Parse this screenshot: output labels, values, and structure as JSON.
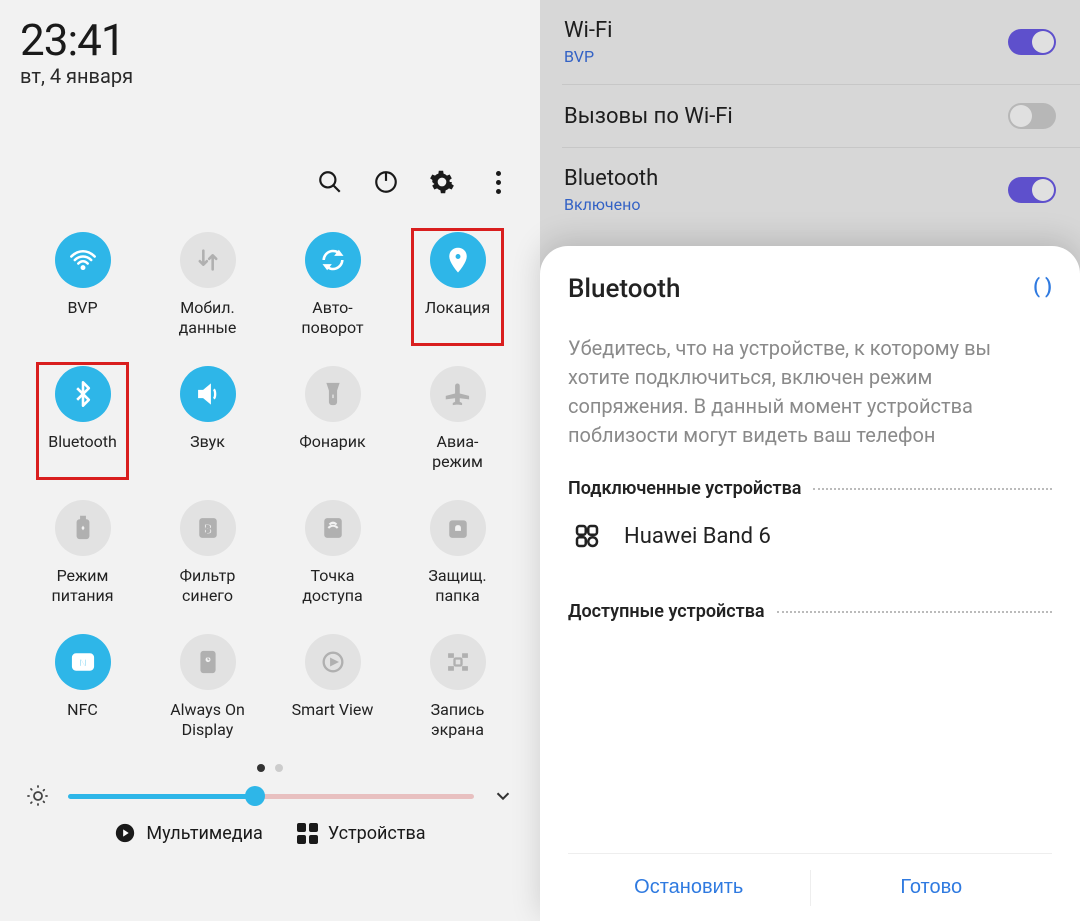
{
  "left": {
    "time": "23:41",
    "date": "вт, 4 января",
    "tiles": [
      {
        "icon": "wifi",
        "on": true,
        "label": "BVP",
        "hl": false,
        "name": "tile-wifi"
      },
      {
        "icon": "data",
        "on": false,
        "label": "Мобил.\nданные",
        "hl": false,
        "name": "tile-mobile-data"
      },
      {
        "icon": "rotate",
        "on": true,
        "label": "Авто-\nповорот",
        "hl": false,
        "name": "tile-auto-rotate"
      },
      {
        "icon": "location",
        "on": true,
        "label": "Локация",
        "hl": true,
        "name": "tile-location"
      },
      {
        "icon": "bluetooth",
        "on": true,
        "label": "Bluetooth",
        "hl": true,
        "name": "tile-bluetooth"
      },
      {
        "icon": "sound",
        "on": true,
        "label": "Звук",
        "hl": false,
        "name": "tile-sound"
      },
      {
        "icon": "torch",
        "on": false,
        "label": "Фонарик",
        "hl": false,
        "name": "tile-flashlight"
      },
      {
        "icon": "plane",
        "on": false,
        "label": "Авиа-\nрежим",
        "hl": false,
        "name": "tile-airplane"
      },
      {
        "icon": "battery",
        "on": false,
        "label": "Режим\nпитания",
        "hl": false,
        "name": "tile-power-mode"
      },
      {
        "icon": "bluelight",
        "on": false,
        "label": "Фильтр\nсинего",
        "hl": false,
        "name": "tile-blue-light"
      },
      {
        "icon": "hotspot",
        "on": false,
        "label": "Точка\nдоступа",
        "hl": false,
        "name": "tile-hotspot"
      },
      {
        "icon": "secure",
        "on": false,
        "label": "Защищ.\nпапка",
        "hl": false,
        "name": "tile-secure-folder"
      },
      {
        "icon": "nfc",
        "on": true,
        "label": "NFC",
        "hl": false,
        "name": "tile-nfc"
      },
      {
        "icon": "aod",
        "on": false,
        "label": "Always On\nDisplay",
        "hl": false,
        "name": "tile-aod"
      },
      {
        "icon": "smartview",
        "on": false,
        "label": "Smart View",
        "hl": false,
        "name": "tile-smart-view"
      },
      {
        "icon": "record",
        "on": false,
        "label": "Запись\nэкрана",
        "hl": false,
        "name": "tile-screen-record"
      }
    ],
    "bottom": {
      "multimedia": "Мультимедиа",
      "devices": "Устройства"
    }
  },
  "right": {
    "settings": [
      {
        "title": "Wi-Fi",
        "sub": "BVP",
        "toggle": true,
        "name": "setting-wifi"
      },
      {
        "title": "Вызовы по Wi-Fi",
        "sub": "",
        "toggle": false,
        "name": "setting-wifi-calling"
      },
      {
        "title": "Bluetooth",
        "sub": "Включено",
        "toggle": true,
        "name": "setting-bluetooth"
      }
    ],
    "sheet": {
      "title": "Bluetooth",
      "spinner": "(   )",
      "desc": "Убедитесь, что на устройстве, к которому вы хотите подключиться, включен режим сопряжения. В данный момент устройства поблизости могут видеть ваш телефон",
      "connected_label": "Подключенные устройства",
      "available_label": "Доступные устройства",
      "device": "Huawei Band 6",
      "stop": "Остановить",
      "done": "Готово"
    }
  }
}
